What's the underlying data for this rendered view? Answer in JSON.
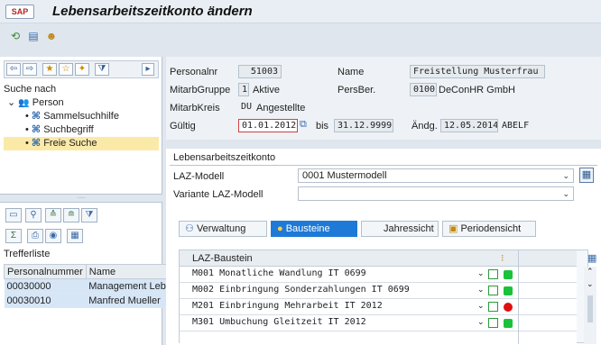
{
  "window": {
    "menu_label": "SAP",
    "title": "Lebensarbeitszeitkonto ändern"
  },
  "search": {
    "heading": "Suche nach",
    "tree": [
      {
        "label": "Person",
        "level": 0
      },
      {
        "label": "Sammelsuchhilfe",
        "level": 1
      },
      {
        "label": "Suchbegriff",
        "level": 1
      },
      {
        "label": "Freie Suche",
        "level": 1,
        "selected": true
      }
    ]
  },
  "results": {
    "heading": "Trefferliste",
    "columns": [
      "Personalnummer",
      "Name"
    ],
    "rows": [
      [
        "00030000",
        "Management Leb"
      ],
      [
        "00030010",
        "Manfred Mueller"
      ]
    ]
  },
  "header": {
    "personalnr_label": "Personalnr",
    "personalnr": "51003",
    "name_label": "Name",
    "name": "Freistellung Musterfrau",
    "mitarbgruppe_label": "MitarbGruppe",
    "mitarbgruppe_code": "1",
    "mitarbgruppe_text": "Aktive",
    "persber_label": "PersBer.",
    "persber_code": "0100",
    "persber_text": "DeConHR GmbH",
    "mitarbkreis_label": "MitarbKreis",
    "mitarbkreis_code": "DU",
    "mitarbkreis_text": "Angestellte",
    "gueltig_label": "Gültig",
    "gueltig_von": "01.01.2012",
    "bis_label": "bis",
    "gueltig_bis": "31.12.9999",
    "aendg_label": "Ändg.",
    "aendg_datum": "12.05.2014",
    "aendg_user": "ABELF"
  },
  "laz": {
    "section_title": "Lebensarbeitszeitkonto",
    "modell_label": "LAZ-Modell",
    "modell_value": "0001 Mustermodell",
    "variante_label": "Variante LAZ-Modell",
    "variante_value": ""
  },
  "tabs": [
    {
      "label": "Verwaltung",
      "active": false
    },
    {
      "label": "Bausteine",
      "active": true
    },
    {
      "label": "Jahressicht",
      "active": false
    },
    {
      "label": "Periodensicht",
      "active": false
    }
  ],
  "bausteine": {
    "column": "LAZ-Baustein",
    "rows": [
      {
        "text": "M001 Monatliche Wandlung IT 0699",
        "status": "green"
      },
      {
        "text": "M002 Einbringung Sonderzahlungen IT 0699",
        "status": "green"
      },
      {
        "text": "M201 Einbringung Mehrarbeit IT 2012",
        "status": "red"
      },
      {
        "text": "M301 Umbuchung Gleitzeit IT 2012",
        "status": "green"
      }
    ]
  },
  "colors": {
    "active_tab": "#1e7ad6",
    "lamp_green": "#19c23a",
    "lamp_red": "#e01010",
    "selection": "#fbe9a8"
  }
}
